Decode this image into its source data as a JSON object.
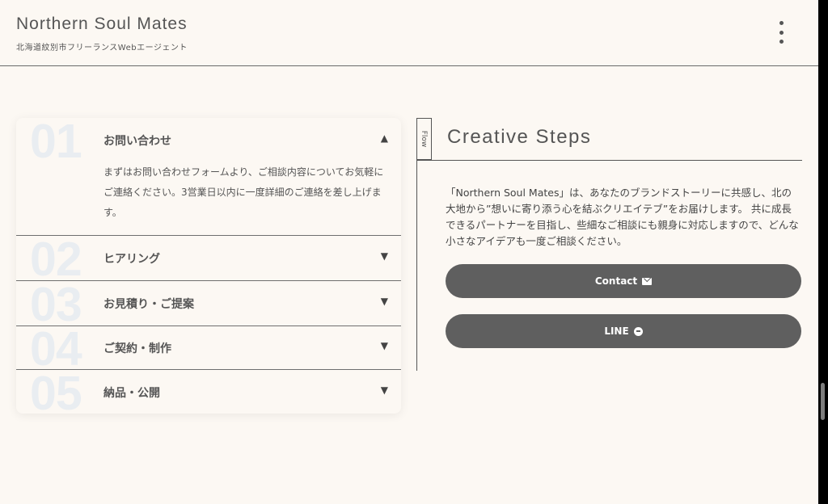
{
  "header": {
    "title": "Northern Soul Mates",
    "subtitle": "北海道紋別市フリーランスWebエージェント",
    "menu_icon": "more-vert-icon"
  },
  "accordion": {
    "items": [
      {
        "num": "01",
        "title": "お問い合わせ",
        "arrow": "▲",
        "expanded": true,
        "body": "まずはお問い合わせフォームより、ご相談内容についてお気軽にご連絡ください。3営業日以内に一度詳細のご連絡を差し上げます。"
      },
      {
        "num": "02",
        "title": "ヒアリング",
        "arrow": "▼",
        "expanded": false
      },
      {
        "num": "03",
        "title": "お見積り・ご提案",
        "arrow": "▼",
        "expanded": false
      },
      {
        "num": "04",
        "title": "ご契約・制作",
        "arrow": "▼",
        "expanded": false
      },
      {
        "num": "05",
        "title": "納品・公開",
        "arrow": "▼",
        "expanded": false
      }
    ]
  },
  "steps": {
    "tab_label": "Flow",
    "title": "Creative Steps",
    "description": "「Northern Soul Mates」は、あなたのブランドストーリーに共感し、北の大地から”想いに寄り添う心を結ぶクリエイテブ”をお届けします。 共に成長できるパートナーを目指し、些細なご相談にも親身に対応しますので、どんな小さなアイデアも一度ご相談ください。",
    "contact_label": "Contact",
    "contact_icon": "envelope-icon",
    "line_label": "LINE",
    "line_icon": "line-chat-icon"
  }
}
